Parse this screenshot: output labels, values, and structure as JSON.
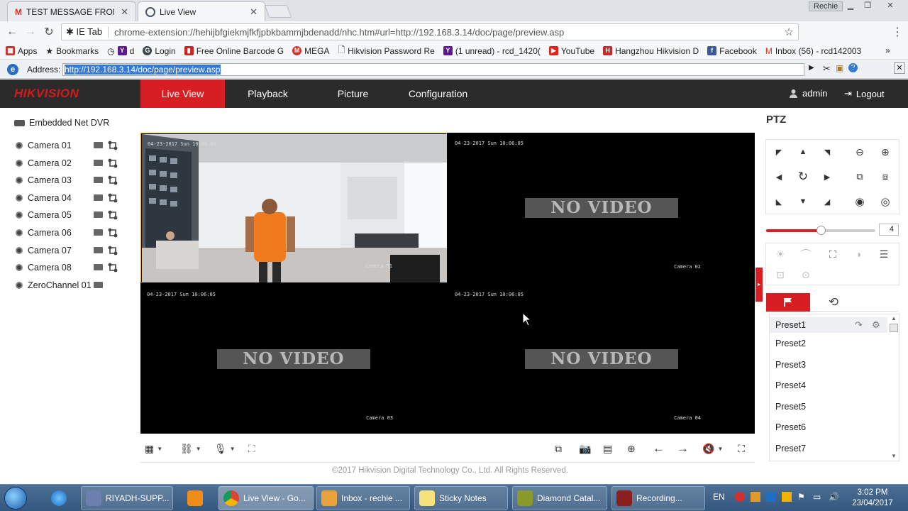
{
  "browser": {
    "tabs": [
      {
        "title": "TEST MESSAGE FROM: Er",
        "icon": "gmail-icon"
      },
      {
        "title": "Live View",
        "icon": "globe-icon"
      }
    ],
    "user_badge": "Rechie",
    "ie_tab_label": "IE Tab",
    "url": "chrome-extension://hehijbfgiekmjfkfjpbkbammjbdenadd/nhc.htm#url=http://192.168.3.14/doc/page/preview.asp",
    "bookmarks": [
      "Apps",
      "Bookmarks",
      "d",
      "Login",
      "Free Online Barcode G",
      "MEGA",
      "Hikvision Password Re",
      "(1 unread) - rcd_1420(",
      "YouTube",
      "Hangzhou Hikvision D",
      "Facebook",
      "Inbox (56) - rcd142003"
    ],
    "ie_address_label": "Address:",
    "ie_address": "http://192.168.3.14/doc/page/preview.asp"
  },
  "app": {
    "logo": "HIKVISION",
    "nav": [
      "Live View",
      "Playback",
      "Picture",
      "Configuration"
    ],
    "user": "admin",
    "logout": "Logout"
  },
  "tree": {
    "device": "Embedded Net DVR",
    "channels": [
      "Camera 01",
      "Camera 02",
      "Camera 03",
      "Camera 04",
      "Camera 05",
      "Camera 06",
      "Camera 07",
      "Camera 08",
      "ZeroChannel 01"
    ]
  },
  "video": {
    "osd_time": "04-23-2017 Sun 10:06:05",
    "no_video": "NO VIDEO",
    "cells": [
      {
        "camera": "Camera 01",
        "has_video": true
      },
      {
        "camera": "Camera 02",
        "has_video": false
      },
      {
        "camera": "Camera 03",
        "has_video": false
      },
      {
        "camera": "Camera 04",
        "has_video": false
      }
    ]
  },
  "footer": "©2017 Hikvision Digital Technology Co., Ltd. All Rights Reserved.",
  "ptz": {
    "title": "PTZ",
    "speed": "4",
    "speed_fraction": 0.5,
    "presets": [
      "Preset1",
      "Preset2",
      "Preset3",
      "Preset4",
      "Preset5",
      "Preset6",
      "Preset7"
    ]
  },
  "taskbar": {
    "items": [
      "RIYADH-SUPP...",
      "Live View - Go...",
      "Inbox - rechie ...",
      "Sticky Notes",
      "Diamond Catal...",
      "Recording..."
    ],
    "language": "EN",
    "time": "3:02 PM",
    "date": "23/04/2017"
  },
  "colors": {
    "brand_red": "#d71e23",
    "header_bg": "#2b2b2b",
    "selected_cell": "#e0a21c"
  }
}
